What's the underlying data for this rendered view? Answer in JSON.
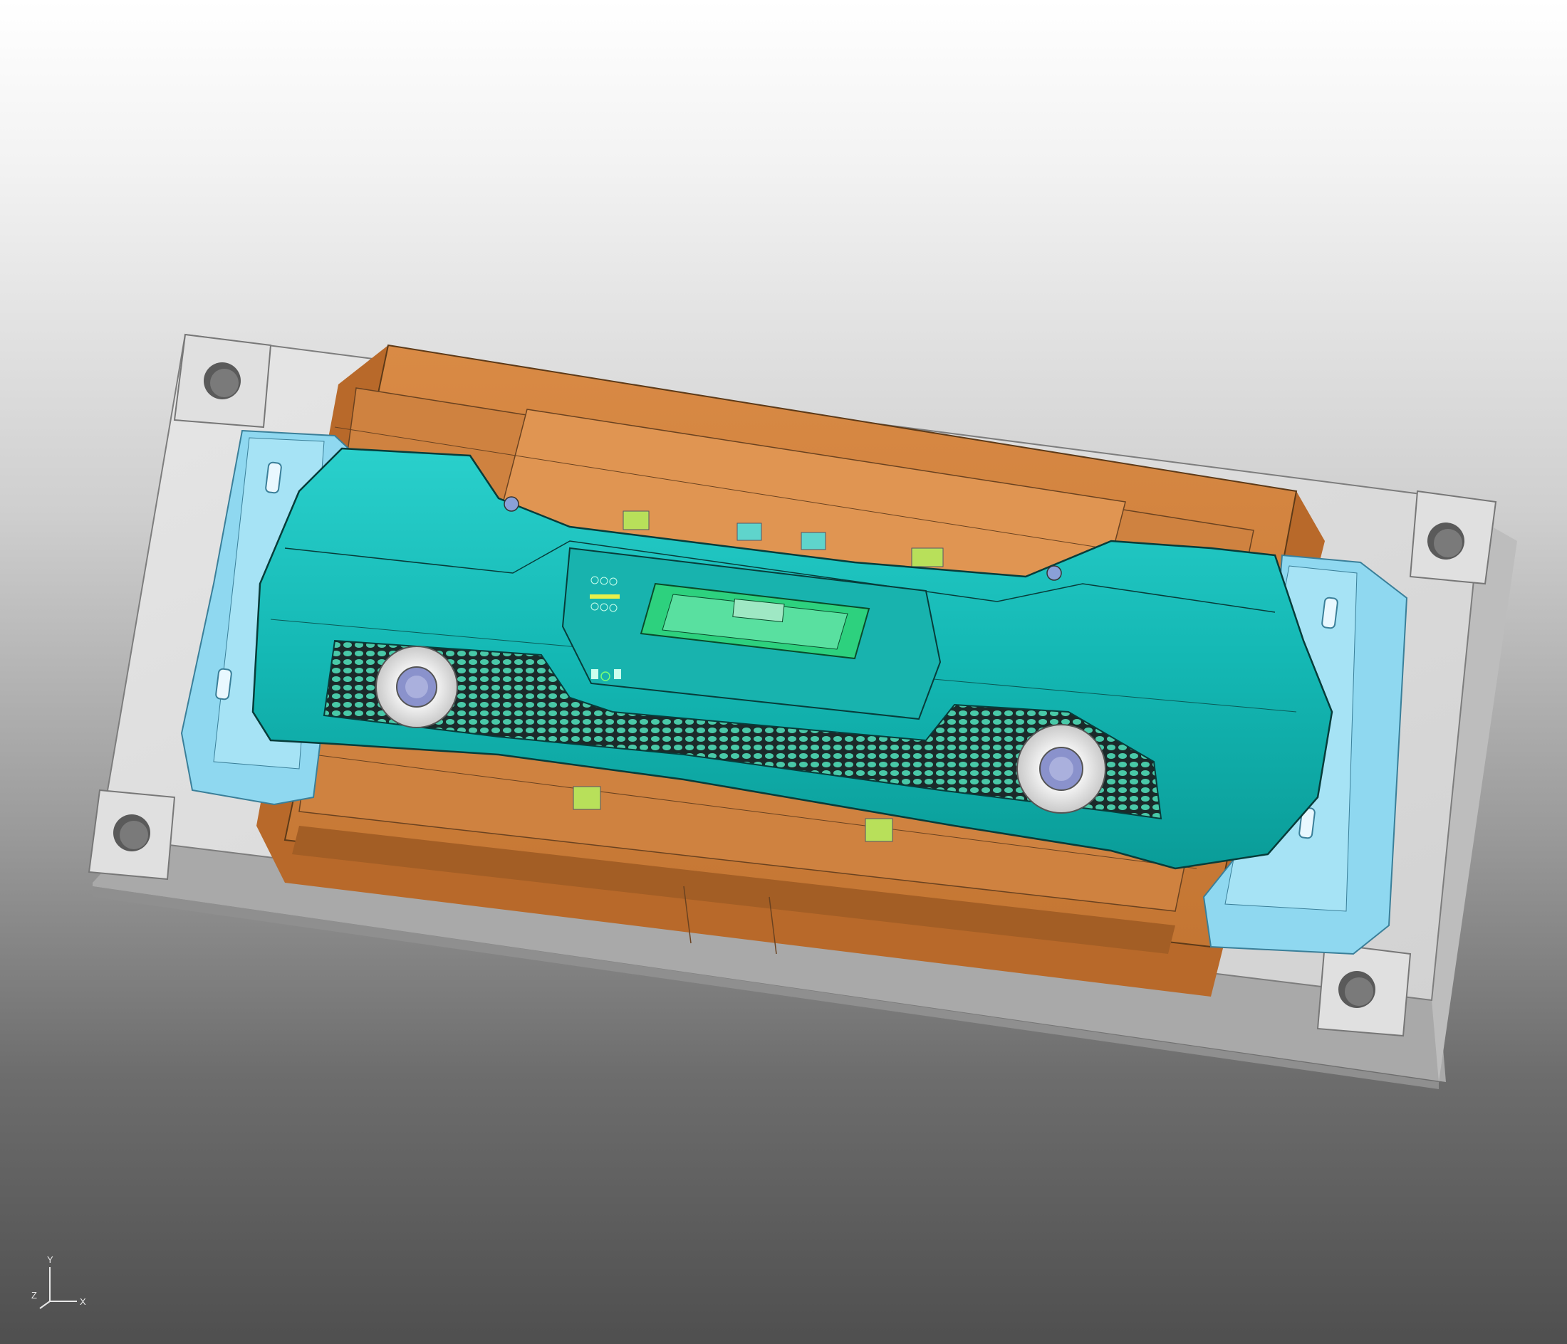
{
  "viewer": {
    "background_top": "#ffffff",
    "background_bottom": "#4f4f4f"
  },
  "model": {
    "part_color": "#1fc4c0",
    "mold_core_color": "#d1843f",
    "mold_base_color": "#d8d8d8",
    "slider_color": "#8fd8f0",
    "insert_color": "#b8e05a"
  },
  "triad": {
    "x_label": "X",
    "y_label": "Y",
    "z_label": "Z"
  }
}
